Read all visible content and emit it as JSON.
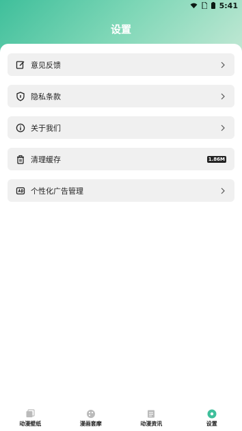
{
  "status_bar": {
    "time": "5:41"
  },
  "header": {
    "title": "设置"
  },
  "menu": {
    "items": [
      {
        "label": "意见反馈",
        "icon": "edit-icon"
      },
      {
        "label": "隐私条款",
        "icon": "shield-icon"
      },
      {
        "label": "关于我们",
        "icon": "info-icon"
      },
      {
        "label": "清理缓存",
        "icon": "trash-icon",
        "value": "1.86M"
      },
      {
        "label": "个性化广告管理",
        "icon": "ad-settings-icon"
      }
    ]
  },
  "tabbar": {
    "tabs": [
      {
        "label": "动漫壁纸",
        "icon": "wallpaper-icon",
        "active": false
      },
      {
        "label": "漫画套摩",
        "icon": "palette-icon",
        "active": false
      },
      {
        "label": "动漫资讯",
        "icon": "news-icon",
        "active": false
      },
      {
        "label": "设置",
        "icon": "settings-icon",
        "active": true
      }
    ]
  },
  "colors": {
    "accent": "#3fbf9b",
    "item_bg": "#f0f0f0"
  }
}
